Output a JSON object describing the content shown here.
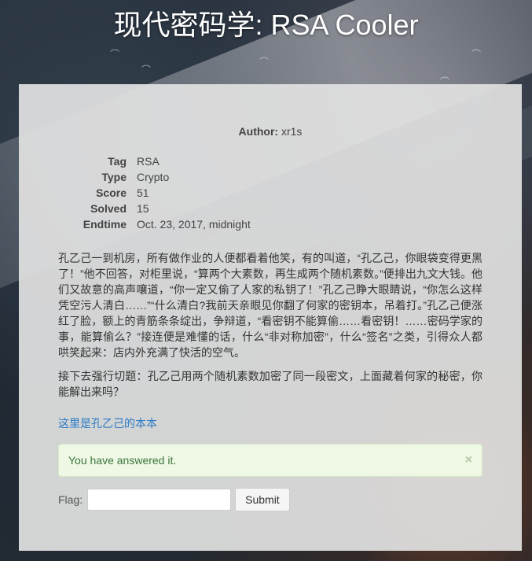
{
  "page": {
    "title": "现代密码学: RSA Cooler"
  },
  "challenge": {
    "author_label": "Author:",
    "author": "xr1s",
    "meta": [
      {
        "key": "Tag",
        "value": "RSA"
      },
      {
        "key": "Type",
        "value": "Crypto"
      },
      {
        "key": "Score",
        "value": "51"
      },
      {
        "key": "Solved",
        "value": "15"
      },
      {
        "key": "Endtime",
        "value": "Oct. 23, 2017, midnight"
      }
    ],
    "description": [
      "孔乙己一到机房，所有做作业的人便都看着他笑，有的叫道，“孔乙己，你眼袋变得更黑了！”他不回答，对柜里说，“算两个大素数，再生成两个随机素数。”便排出九文大钱。他们又故意的高声嚷道，“你一定又偷了人家的私钥了！”孔乙己睁大眼睛说，“你怎么这样凭空污人清白……”“什么清白?我前天亲眼见你翻了何家的密钥本，吊着打。”孔乙己便涨红了脸，额上的青筋条条绽出，争辩道，“看密钥不能算偷……看密钥！……密码学家的事，能算偷么？”接连便是难懂的话，什么“非对称加密”，什么“签名”之类，引得众人都哄笑起来：店内外充满了快活的空气。",
      "接下去强行切题：孔乙己用两个随机素数加密了同一段密文，上面藏着何家的秘密，你能解出来吗？"
    ],
    "download_link": "这里是孔乙己的本本"
  },
  "alert": {
    "message": "You have answered it.",
    "close_glyph": "×"
  },
  "flag_form": {
    "label": "Flag:",
    "value": "",
    "submit_label": "Submit"
  }
}
